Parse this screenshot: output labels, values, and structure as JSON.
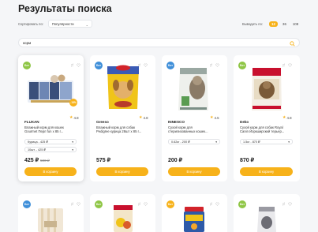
{
  "page": {
    "title": "Результаты поиска"
  },
  "sortbar": {
    "sort_label": "Сортировать по:",
    "sort_value": "Популярности",
    "perpage_label": "Выводить по:",
    "perpage_options": [
      "12",
      "36",
      "108"
    ],
    "perpage_selected": "12"
  },
  "search": {
    "value": "корм"
  },
  "products": [
    {
      "badge": "Бот",
      "discount": "-15%",
      "brand": "FLUXAN",
      "rating": "4.8",
      "desc_line1": "Влажный корм для кошек",
      "desc_line2": "Gourmet Перл fun x 85 г...",
      "option1": "Курица - 425 ₽",
      "option2": "10шт. - 425 ₽",
      "price": "425 ₽",
      "old_price": "500 ₽",
      "cart_label": "В корзину"
    },
    {
      "badge": "Бот",
      "brand": "Greeso",
      "rating": "4.8",
      "desc_line1": "Влажный корм для собак",
      "desc_line2": "Pedigree курица 28шт х 85 г...",
      "price": "575 ₽",
      "cart_label": "В корзину"
    },
    {
      "badge": "Бот",
      "brand": "INNESCO",
      "rating": "4.5",
      "desc_line1": "Сухой корм для",
      "desc_line2": "стерилизованных кошек...",
      "option1": "0.62кг - 200 ₽",
      "price": "200 ₽",
      "cart_label": "В корзину"
    },
    {
      "badge": "Бот",
      "brand": "Deko",
      "rating": "4.8",
      "desc_line1": "Сухой корм для собак Royal",
      "desc_line2": "Canin Йоркширский терьер...",
      "option1": "1.5кг - 870 ₽",
      "price": "870 ₽",
      "cart_label": "В корзину"
    }
  ],
  "bottom_badges": [
    "Бот",
    "Бот",
    "Бот",
    "Бот"
  ],
  "colors": {
    "accent": "#f7b21a",
    "green_badge": "#8fc646",
    "blue_badge": "#3f8fd9"
  }
}
